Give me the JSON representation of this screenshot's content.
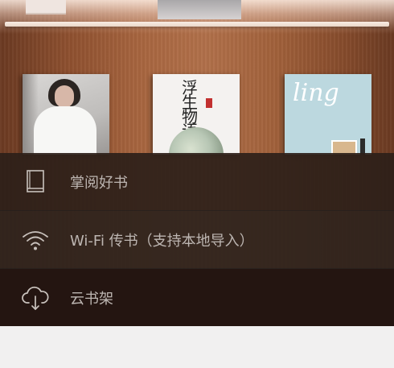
{
  "menu": {
    "items": [
      {
        "label": "掌阅好书",
        "icon": "book-icon"
      },
      {
        "label": "Wi-Fi 传书（支持本地导入）",
        "icon": "wifi-icon"
      },
      {
        "label": "云书架",
        "icon": "cloud-download-icon"
      }
    ]
  },
  "books": [
    {
      "title": "",
      "cover": "portrait-cover"
    },
    {
      "title": "浮生物语",
      "cover": "illustrated-cover"
    },
    {
      "title": "ling",
      "cover": "magazine-cover"
    }
  ]
}
